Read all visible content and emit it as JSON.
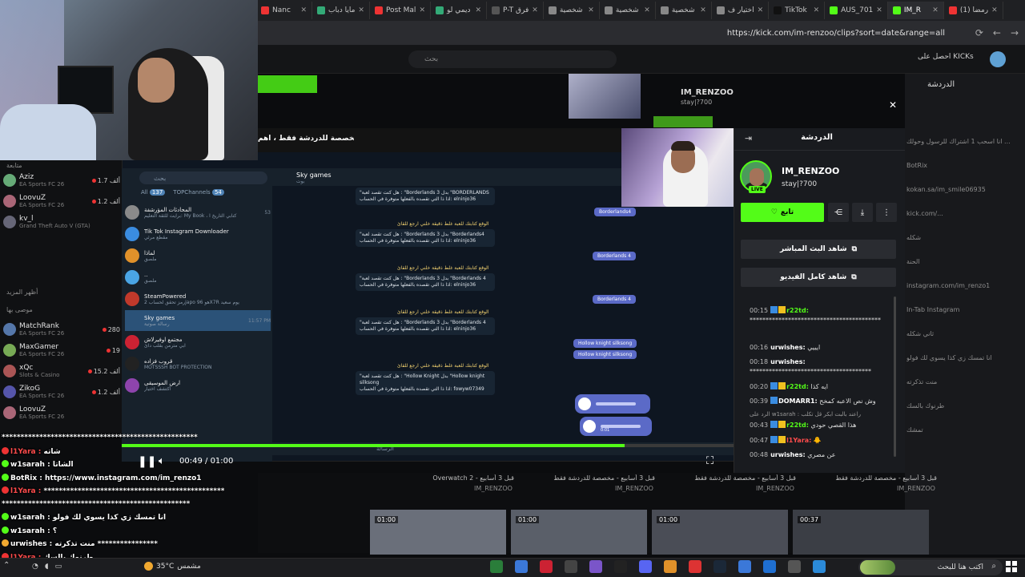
{
  "browser": {
    "tabs": [
      {
        "label": "Nanc",
        "color": "#e33"
      },
      {
        "label": "مايا دباب",
        "color": "#3a7"
      },
      {
        "label": "Post Mal",
        "color": "#e33"
      },
      {
        "label": "ديمي لو",
        "color": "#3a7"
      },
      {
        "label": "P-T فرق",
        "color": "#555"
      },
      {
        "label": "شخصية",
        "color": "#888"
      },
      {
        "label": "شخصية",
        "color": "#888"
      },
      {
        "label": "شخصية",
        "color": "#888"
      },
      {
        "label": "اختيار ف",
        "color": "#888"
      },
      {
        "label": "TikTok",
        "color": "#111"
      },
      {
        "label": "AUS_701",
        "color": "#53fc18"
      },
      {
        "label": "IM_R",
        "color": "#53fc18"
      },
      {
        "label": "(1) رمضا",
        "color": "#e33"
      }
    ],
    "url": "https://kick.com/im-renzoo/clips?sort=date&range=all"
  },
  "kick": {
    "search_placeholder": "بحث",
    "kicks_label": "احصل على KICKs",
    "bg_channel_name": "IM_RENZOO",
    "bg_channel_sub": "stay|?700",
    "right_panel": {
      "title": "الدردشة",
      "lines": [
        "انا اسحب 1 اشتراك للرسول وحولك ...",
        "BotRix",
        "kokan.sa/im_smile06935",
        "kick.com/...",
        "شكله",
        "الحنة",
        "instagram.com/im_renzo1",
        "In-Tab Instagram",
        "ثاني شكله",
        "انا تمسك زي كذا يسوي لك فولو",
        "منت تذكرته",
        "طرنوك بالسك",
        "تمشك"
      ]
    }
  },
  "left_list": {
    "following_label": "متابعة",
    "show_more": "أظهر المزيد",
    "recommended_label": "موصى بها",
    "channels": [
      {
        "name": "Aziz",
        "game": "EA Sports FC 26",
        "viewers": "1.7 ألف",
        "color": "#6a7"
      },
      {
        "name": "LoovuZ",
        "game": "EA Sports FC 26",
        "viewers": "1.2 ألف",
        "color": "#a67"
      },
      {
        "name": "kv_l",
        "game": "Grand Theft Auto V (GTA)",
        "viewers": "",
        "color": "#667"
      }
    ],
    "recommended": [
      {
        "name": "MatchRank",
        "game": "EA Sports FC 26",
        "viewers": "280",
        "color": "#57a"
      },
      {
        "name": "MaxGamer",
        "game": "EA Sports FC 26",
        "viewers": "19",
        "color": "#7a5"
      },
      {
        "name": "xQc",
        "game": "Slots & Casino",
        "viewers": "15.2 ألف",
        "color": "#a55"
      },
      {
        "name": "ZikoG",
        "game": "EA Sports FC 26",
        "viewers": "1.2 ألف",
        "color": "#55a"
      },
      {
        "name": "LoovuZ",
        "game": "EA Sports FC 26",
        "viewers": "",
        "color": "#a67"
      }
    ]
  },
  "telegram": {
    "banner": "مخصصة للدردشة فقط ، اهم",
    "search_placeholder": "بحث",
    "filters": [
      {
        "label": "All",
        "count": "137"
      },
      {
        "label": "TOPChannels",
        "count": "54"
      }
    ],
    "chats": [
      {
        "name": "المحادثات المؤرشفة",
        "preview": "برايت للثقة التعليم: My Book ، كتابي التاريخ ا",
        "meta": "53",
        "color": "#8a8a8a"
      },
      {
        "name": "Tik Tok Instagram Downloader",
        "preview": "مقطع مرئي",
        "meta": "",
        "color": "#3a8ce0"
      },
      {
        "name": "لماذا",
        "preview": "ملصق",
        "meta": "",
        "color": "#e0912a"
      },
      {
        "name": "..",
        "preview": "ملصق",
        "meta": "",
        "color": "#4aa5e5"
      },
      {
        "name": "SteamPowered",
        "preview": "رمز تحقق لحساب 2japo هو 96X7R يوم سعيد",
        "meta": "",
        "color": "#c0392b"
      },
      {
        "name": "Sky games",
        "preview": "رسالة صوتية",
        "meta": "11:57 PM",
        "color": "#2b5278"
      },
      {
        "name": "مجتمع اوفيرلاش",
        "preview": "ابي مترمن بقلب دائ",
        "meta": "",
        "color": "#c23"
      },
      {
        "name": "قروب فزاده",
        "preview": "MOTSSSH BOT PROTECTION",
        "meta": "",
        "color": "#222"
      },
      {
        "name": "ارض الموسيقى",
        "preview": "اكتشف اختيار",
        "meta": "",
        "color": "#8e44ad"
      }
    ],
    "header_name": "Sky games",
    "header_sub": "بوت",
    "messages_in": [
      {
        "hdr": "",
        "l1": "\"هل كنت تقصد لعبة : \"Borderlands 3 بدل \"BORDERLANDS",
        "l2": "اذا ذا التي تقصده بالفعلها متوفرة في الحساب: elninjo36"
      },
      {
        "hdr": "الوقع كتابتك للعبة غلط ذقيقة خلني ارجع للقائ",
        "l1": "\"هل كنت تقصد لعبة : \"Borderlands 3 بدل \"Borderlands4",
        "l2": "اذا ذا التي تقصده بالفعلها متوفرة في الحساب: elninjo36"
      },
      {
        "hdr": "الوقع كتابتك للعبة غلط ذقيقة خلني ارجع للقائ",
        "l1": "\"هل كنت تقصد لعبة : \"Borderlands 3 بدل \"Borderlands 4",
        "l2": "اذا ذا التي تقصده بالفعلها متوفرة في الحساب: elninjo36"
      },
      {
        "hdr": "الوقع كتابتك للعبة غلط ذقيقة خلني ارجع للقائ",
        "l1": "\"هل كنت تقصد لعبة : \"Borderlands 3 بدل \"Borderlands 4",
        "l2": "اذا ذا التي تقصده بالفعلها متوفرة في الحساب: elninjo36"
      },
      {
        "hdr": "الوقع كتابتك للعبة غلط ذقيقة خلني ارجع للقائ",
        "l1": "\"هل كنت تقصد لعبة : \"Hollow Knight بدل \"Hollow knight silksong",
        "l2": "اذا ذا التي تقصده بالفعلها متوفرة في الحساب: fowyw07349"
      }
    ],
    "messages_out": [
      "Borderlands4",
      "Borderlands 4",
      "Borderlands 4",
      "Hollow knight silksong",
      "Hollow knight silksong"
    ],
    "voice_duration": "0:01",
    "input_placeholder": "الرسالة"
  },
  "player": {
    "time_current": "00:49",
    "time_total": "01:00",
    "progress": 0.82
  },
  "clip_panel": {
    "title": "الدردشة",
    "channel_name": "IM_RENZOO",
    "channel_sub": "stay|?700",
    "live_badge": "LIVE",
    "follow_label": "تابع",
    "watch_live_label": "شاهد البث المباشر",
    "watch_full_label": "شاهد كامل الفيديو",
    "chat": [
      {
        "time": "00:15",
        "user": "r22td:",
        "color": "#53fc18",
        "badges": 2,
        "msg": "*****************************************"
      },
      {
        "time": "00:16",
        "user": "urwishes:",
        "color": "#ffffff",
        "badges": 0,
        "msg": "ايييي"
      },
      {
        "time": "00:18",
        "user": "urwishes:",
        "color": "#ffffff",
        "badges": 0,
        "msg": "**************************************"
      },
      {
        "time": "00:20",
        "user": "r22td:",
        "color": "#53fc18",
        "badges": 2,
        "msg": "ايه كذا"
      },
      {
        "time": "00:39",
        "user": "DOMARR1:",
        "color": "#ffffff",
        "badges": 1,
        "msg": "وش نص الاعبه كمخح"
      },
      {
        "time": "00:43",
        "user": "r22td:",
        "color": "#53fc18",
        "badges": 2,
        "msg": "هذا القصي حودي"
      },
      {
        "time": "00:47",
        "user": "l1Yara:",
        "color": "#ff4c4c",
        "badges": 2,
        "msg": "🐥"
      },
      {
        "time": "00:48",
        "user": "urwishes:",
        "color": "#ffffff",
        "badges": 0,
        "msg": "عن مصري"
      }
    ],
    "reply_hint": "الرد على w1sarah : راعند بالبت ابكر قل تكلب"
  },
  "overlay_chat": [
    {
      "user": "",
      "msg": "****************************************************",
      "color": "#ffffff",
      "icon": ""
    },
    {
      "user": "l1Yara",
      "msg": "شاته",
      "color": "#ff4c4c",
      "icon": "#e33"
    },
    {
      "user": "w1sarah",
      "msg": "الشاتا",
      "color": "#ffffff",
      "icon": "#53fc18"
    },
    {
      "user": "BotRix",
      "msg": "https://www.instagram.com/im_renzo1",
      "color": "#ffffff",
      "icon": "#53fc18"
    },
    {
      "user": "l1Yara",
      "msg": "************************************************",
      "color": "#ff4c4c",
      "icon": "#e33"
    },
    {
      "user": "",
      "msg": "**************************************************",
      "color": "#ffffff",
      "icon": ""
    },
    {
      "user": "w1sarah",
      "msg": "انا تمسك زي كذا يسوي لك فولو",
      "color": "#ffffff",
      "icon": "#53fc18"
    },
    {
      "user": "w1sarah",
      "msg": "؟",
      "color": "#ffffff",
      "icon": "#53fc18"
    },
    {
      "user": "urwishes",
      "msg": "منت تذكرته ****************",
      "color": "#ffffff",
      "icon": "#f0a830"
    },
    {
      "user": "l1Yara",
      "msg": "طرنوك بالسك",
      "color": "#ff4c4c",
      "icon": "#e33"
    },
    {
      "user": "w1sarah",
      "msg": "تمشك",
      "color": "#ffffff",
      "icon": "#53fc18"
    }
  ],
  "thumbnails": [
    {
      "title": "قبل 3 أسابيع - مخصصة للدردشة فقط",
      "name": "IM_RENZOO",
      "duration": "00:37",
      "color": "#3b3e45"
    },
    {
      "title": "قبل 3 أسابيع - مخصصة للدردشة فقط",
      "name": "IM_RENZOO",
      "duration": "01:00",
      "color": "#4a4d56"
    },
    {
      "title": "قبل 3 أسابيع - مخصصة للدردشة فقط",
      "name": "IM_RENZOO",
      "duration": "01:00",
      "color": "#5a5f69"
    },
    {
      "title": "Overwatch 2 - قبل 3 أسابيع",
      "name": "IM_RENZOO",
      "duration": "01:00",
      "color": "#6a6f7a"
    }
  ],
  "taskbar": {
    "search_placeholder": "اكتب هنا للبحث",
    "weather_temp": "35°C",
    "weather_text": "مشمس",
    "apps": [
      "#2a7d3a",
      "#3b78d8",
      "#c23",
      "#444",
      "#7a55c9",
      "#222",
      "#5865f2",
      "#e0912a",
      "#d33",
      "#1b2838",
      "#3b78d8",
      "#1f6fd1",
      "#555",
      "#2b8ad8"
    ]
  }
}
